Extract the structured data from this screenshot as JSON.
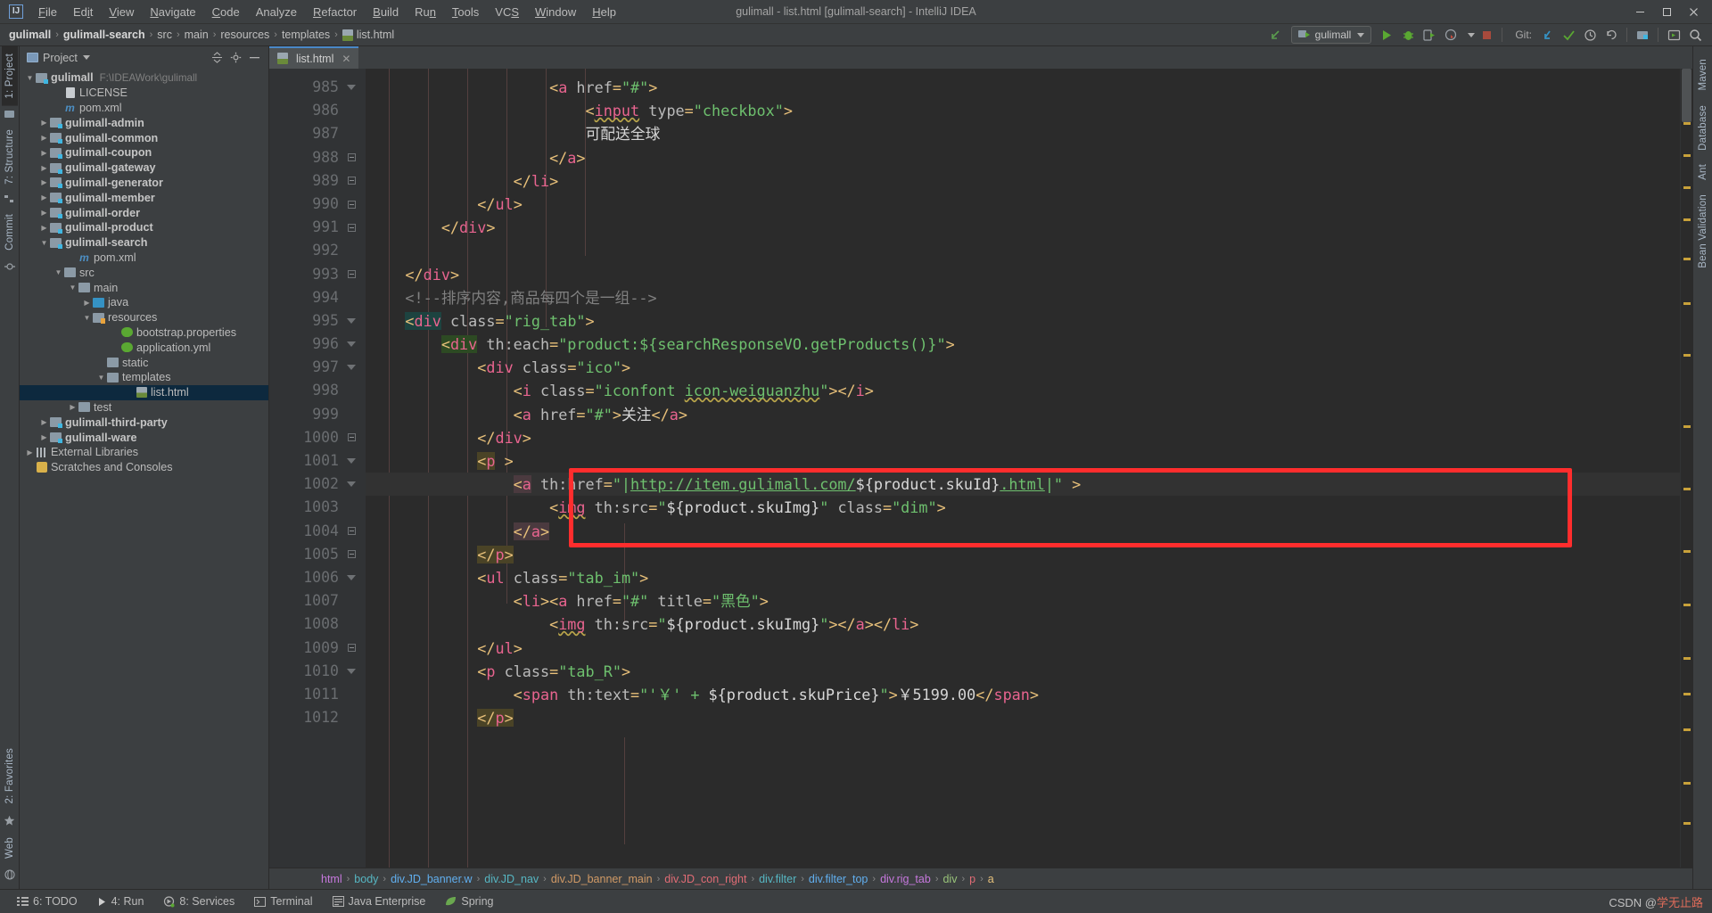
{
  "window": {
    "title": "gulimall - list.html [gulimall-search] - IntelliJ IDEA",
    "logo": "IJ",
    "minimize": "—",
    "maximize": "☐",
    "close": "✕"
  },
  "menu": [
    {
      "label": "File"
    },
    {
      "label": "Edit"
    },
    {
      "label": "View"
    },
    {
      "label": "Navigate"
    },
    {
      "label": "Code"
    },
    {
      "label": "Analyze"
    },
    {
      "label": "Refactor"
    },
    {
      "label": "Build"
    },
    {
      "label": "Run"
    },
    {
      "label": "Tools"
    },
    {
      "label": "VCS"
    },
    {
      "label": "Window"
    },
    {
      "label": "Help"
    }
  ],
  "navbar": {
    "crumbs": [
      {
        "label": "gulimall",
        "bold": true
      },
      {
        "label": "gulimall-search",
        "bold": true
      },
      {
        "label": "src",
        "bold": false
      },
      {
        "label": "main",
        "bold": false
      },
      {
        "label": "resources",
        "bold": false
      },
      {
        "label": "templates",
        "bold": false
      },
      {
        "label": "list.html",
        "bold": false,
        "icon": "html-file-icon"
      }
    ],
    "separator": "›",
    "run_config": "gulimall",
    "git_label": "Git:",
    "icons": [
      "back-arrow-icon",
      "run-icon",
      "debug-icon",
      "run-coverage-icon",
      "profiler-icon",
      "stop-icon",
      "update-project-icon",
      "commit-icon",
      "rollback-icon",
      "history-icon",
      "project-structure-icon",
      "select-in-icon",
      "search-everywhere-icon"
    ]
  },
  "left_strip": {
    "top": [
      "1: Project",
      "7: Structure",
      "Commit"
    ],
    "bottom": [
      "2: Favorites",
      "Web"
    ]
  },
  "right_strip": {
    "items": [
      "Maven",
      "Database",
      "Ant",
      "Bean Validation"
    ]
  },
  "project_panel": {
    "title": "Project",
    "actions": [
      "collapse-all-icon",
      "settings-icon",
      "hide-icon"
    ],
    "tree": [
      {
        "depth": 0,
        "arrow": "down",
        "icon": "module-icon",
        "label": "gulimall",
        "bold": true,
        "path": "F:\\IDEAWork\\gulimall"
      },
      {
        "depth": 2,
        "arrow": "none",
        "icon": "license-icon",
        "label": "LICENSE",
        "bold": false,
        "path": ""
      },
      {
        "depth": 2,
        "arrow": "none",
        "icon": "maven-icon",
        "label": "pom.xml",
        "bold": false,
        "path": ""
      },
      {
        "depth": 1,
        "arrow": "right",
        "icon": "module-icon",
        "label": "gulimall-admin",
        "bold": true,
        "path": ""
      },
      {
        "depth": 1,
        "arrow": "right",
        "icon": "module-icon",
        "label": "gulimall-common",
        "bold": true,
        "path": ""
      },
      {
        "depth": 1,
        "arrow": "right",
        "icon": "module-icon",
        "label": "gulimall-coupon",
        "bold": true,
        "path": ""
      },
      {
        "depth": 1,
        "arrow": "right",
        "icon": "module-icon",
        "label": "gulimall-gateway",
        "bold": true,
        "path": ""
      },
      {
        "depth": 1,
        "arrow": "right",
        "icon": "module-icon",
        "label": "gulimall-generator",
        "bold": true,
        "path": ""
      },
      {
        "depth": 1,
        "arrow": "right",
        "icon": "module-icon",
        "label": "gulimall-member",
        "bold": true,
        "path": ""
      },
      {
        "depth": 1,
        "arrow": "right",
        "icon": "module-icon",
        "label": "gulimall-order",
        "bold": true,
        "path": ""
      },
      {
        "depth": 1,
        "arrow": "right",
        "icon": "module-icon",
        "label": "gulimall-product",
        "bold": true,
        "path": ""
      },
      {
        "depth": 1,
        "arrow": "down",
        "icon": "module-icon",
        "label": "gulimall-search",
        "bold": true,
        "path": ""
      },
      {
        "depth": 3,
        "arrow": "none",
        "icon": "maven-icon",
        "label": "pom.xml",
        "bold": false,
        "path": ""
      },
      {
        "depth": 2,
        "arrow": "down",
        "icon": "folder-icon",
        "label": "src",
        "bold": false,
        "path": ""
      },
      {
        "depth": 3,
        "arrow": "down",
        "icon": "folder-icon",
        "label": "main",
        "bold": false,
        "path": ""
      },
      {
        "depth": 4,
        "arrow": "right",
        "icon": "source-folder-icon",
        "label": "java",
        "bold": false,
        "path": ""
      },
      {
        "depth": 4,
        "arrow": "down",
        "icon": "resource-folder-icon",
        "label": "resources",
        "bold": false,
        "path": ""
      },
      {
        "depth": 6,
        "arrow": "none",
        "icon": "spring-icon",
        "label": "bootstrap.properties",
        "bold": false,
        "path": ""
      },
      {
        "depth": 6,
        "arrow": "none",
        "icon": "spring-yml-icon",
        "label": "application.yml",
        "bold": false,
        "path": ""
      },
      {
        "depth": 5,
        "arrow": "none",
        "icon": "folder-icon",
        "label": "static",
        "bold": false,
        "path": ""
      },
      {
        "depth": 5,
        "arrow": "down",
        "icon": "folder-icon",
        "label": "templates",
        "bold": false,
        "path": ""
      },
      {
        "depth": 7,
        "arrow": "none",
        "icon": "html-file-icon",
        "label": "list.html",
        "bold": false,
        "path": "",
        "selected": true
      },
      {
        "depth": 3,
        "arrow": "right",
        "icon": "folder-icon",
        "label": "test",
        "bold": false,
        "path": ""
      },
      {
        "depth": 1,
        "arrow": "right",
        "icon": "module-icon",
        "label": "gulimall-third-party",
        "bold": true,
        "path": ""
      },
      {
        "depth": 1,
        "arrow": "right",
        "icon": "module-icon",
        "label": "gulimall-ware",
        "bold": true,
        "path": ""
      },
      {
        "depth": 0,
        "arrow": "right",
        "icon": "library-icon",
        "label": "External Libraries",
        "bold": false,
        "path": ""
      },
      {
        "depth": 0,
        "arrow": "none",
        "icon": "scratch-icon",
        "label": "Scratches and Consoles",
        "bold": false,
        "path": ""
      }
    ]
  },
  "editor": {
    "tab": {
      "label": "list.html",
      "icon": "html-file-icon",
      "close": "✕"
    },
    "first_line": 985,
    "lines": [
      {
        "n": 985,
        "fold": "tri-dn",
        "indent": 5
      },
      {
        "n": 986,
        "fold": "",
        "indent": 6
      },
      {
        "n": 987,
        "fold": "",
        "indent": 6
      },
      {
        "n": 988,
        "fold": "sq",
        "indent": 5
      },
      {
        "n": 989,
        "fold": "sq",
        "indent": 4
      },
      {
        "n": 990,
        "fold": "sq",
        "indent": 3
      },
      {
        "n": 991,
        "fold": "sq",
        "indent": 2
      },
      {
        "n": 992,
        "fold": "",
        "indent": 0
      },
      {
        "n": 993,
        "fold": "sq",
        "indent": 2
      },
      {
        "n": 994,
        "fold": "",
        "indent": 2
      },
      {
        "n": 995,
        "fold": "tri-dn",
        "indent": 2
      },
      {
        "n": 996,
        "fold": "tri-dn",
        "indent": 3
      },
      {
        "n": 997,
        "fold": "tri-dn",
        "indent": 4
      },
      {
        "n": 998,
        "fold": "",
        "indent": 5
      },
      {
        "n": 999,
        "fold": "",
        "indent": 5
      },
      {
        "n": 1000,
        "fold": "sq",
        "indent": 4
      },
      {
        "n": 1001,
        "fold": "tri-dn",
        "indent": 4
      },
      {
        "n": 1002,
        "fold": "tri-dn",
        "indent": 5
      },
      {
        "n": 1003,
        "fold": "",
        "indent": 6
      },
      {
        "n": 1004,
        "fold": "sq",
        "indent": 5
      },
      {
        "n": 1005,
        "fold": "sq",
        "indent": 4
      },
      {
        "n": 1006,
        "fold": "tri-dn",
        "indent": 4
      },
      {
        "n": 1007,
        "fold": "",
        "indent": 5
      },
      {
        "n": 1008,
        "fold": "",
        "indent": 6
      },
      {
        "n": 1009,
        "fold": "sq",
        "indent": 4
      },
      {
        "n": 1010,
        "fold": "tri-dn",
        "indent": 4
      },
      {
        "n": 1011,
        "fold": "",
        "indent": 5
      },
      {
        "n": 1012,
        "fold": "",
        "indent": 4
      }
    ],
    "code_text": [
      "                    <a href=\"#\">",
      "                        <input type=\"checkbox\">",
      "                        可配送全球",
      "                    </a>",
      "                </li>",
      "            </ul>",
      "        </div>",
      "",
      "    </div>",
      "    <!--排序内容,商品每四个是一组-->",
      "    <div class=\"rig_tab\">",
      "        <div th:each=\"product:${searchResponseVO.getProducts()}\">",
      "            <div class=\"ico\">",
      "                <i class=\"iconfont icon-weiguanzhu\"></i>",
      "                <a href=\"#\">关注</a>",
      "            </div>",
      "            <p >",
      "                <a th:href=\"|http://item.gulimall.com/${product.skuId}.html|\" >",
      "                    <img th:src=\"${product.skuImg}\" class=\"dim\">",
      "                </a>",
      "            </p>",
      "            <ul class=\"tab_im\">",
      "                <li><a href=\"#\" title=\"黑色\">",
      "                    <img th:src=\"${product.skuImg}\"></a></li>",
      "            </ul>",
      "            <p class=\"tab_R\">",
      "                <span th:text=\"'￥' + ${product.skuPrice}\">￥5199.00</span>",
      "            </p>"
    ],
    "annotation": {
      "type": "red-rectangle",
      "color": "#ff2d2d",
      "covers_lines": [
        1002,
        1003,
        1004
      ]
    },
    "breadcrumb": [
      {
        "label": "html",
        "color": "#c678dd"
      },
      {
        "label": "body",
        "color": "#56b6c2"
      },
      {
        "label": "div.JD_banner.w",
        "color": "#61afef"
      },
      {
        "label": "div.JD_nav",
        "color": "#56b6c2"
      },
      {
        "label": "div.JD_banner_main",
        "color": "#d19a66"
      },
      {
        "label": "div.JD_con_right",
        "color": "#e06c75"
      },
      {
        "label": "div.filter",
        "color": "#56b6c2"
      },
      {
        "label": "div.filter_top",
        "color": "#61afef"
      },
      {
        "label": "div.rig_tab",
        "color": "#c678dd"
      },
      {
        "label": "div",
        "color": "#98c379"
      },
      {
        "label": "p",
        "color": "#e06c75"
      },
      {
        "label": "a",
        "color": "#e5c07b"
      }
    ],
    "breadcrumb_separator": "›"
  },
  "statusbar": {
    "items": [
      {
        "label": "6: TODO",
        "icon": "todo-icon"
      },
      {
        "label": "4: Run",
        "icon": "run-icon"
      },
      {
        "label": "8: Services",
        "icon": "services-icon"
      },
      {
        "label": "Terminal",
        "icon": "terminal-icon"
      },
      {
        "label": "Java Enterprise",
        "icon": "java-enterprise-icon"
      },
      {
        "label": "Spring",
        "icon": "spring-icon"
      }
    ],
    "watermark_prefix": "CSDN @",
    "watermark_name": "学无止路"
  },
  "colors": {
    "accent": "#4a88c7",
    "annotation_red": "#ff2d2d",
    "selection_blue": "#0d293e",
    "editor_bg": "#2b2b2b",
    "panel_bg": "#3c3f41",
    "gutter_bg": "#313335"
  }
}
